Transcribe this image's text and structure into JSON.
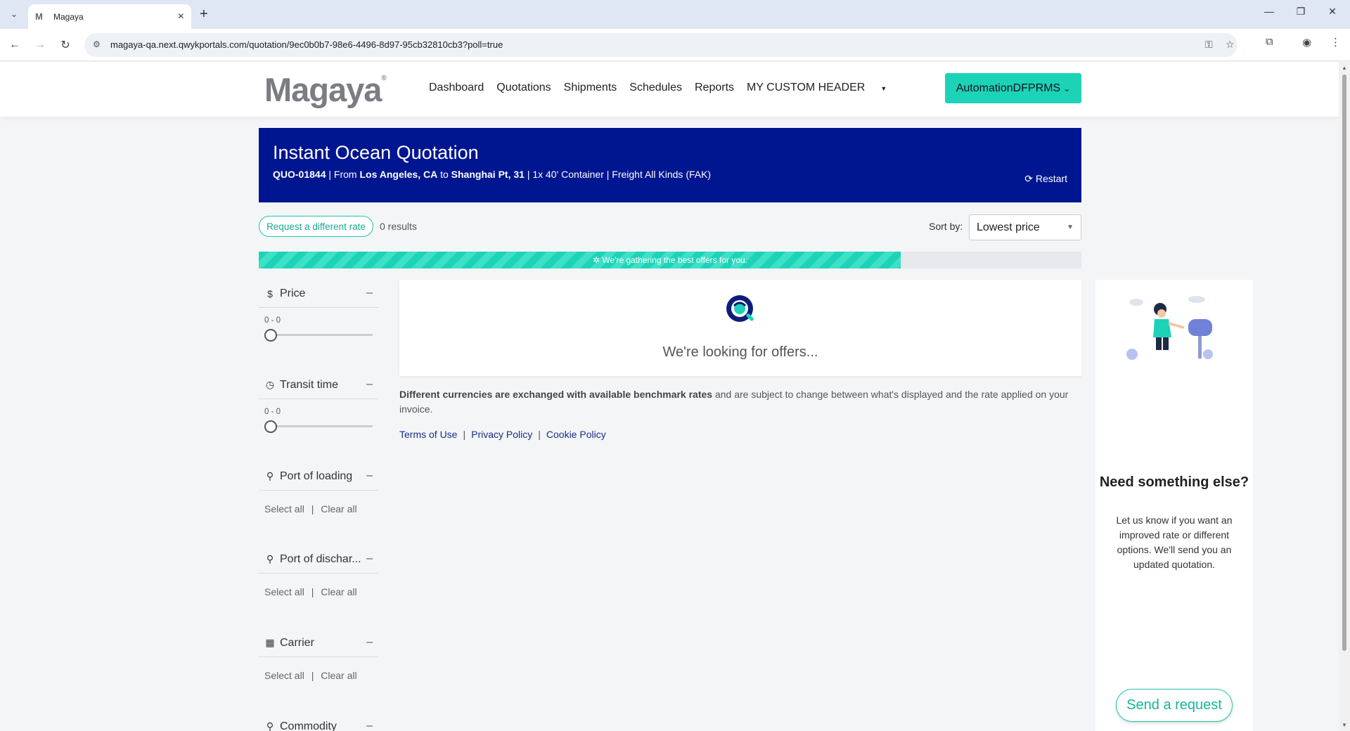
{
  "browser": {
    "tab_title": "Magaya",
    "tab_favicon": "M",
    "url": "magaya-qa.next.qwykportals.com/quotation/9ec0b0b7-98e6-4496-8d97-95cb32810cb3?poll=true"
  },
  "header": {
    "logo": "Magaya",
    "nav": [
      "Dashboard",
      "Quotations",
      "Shipments",
      "Schedules",
      "Reports",
      "MY CUSTOM HEADER"
    ],
    "user_label": "AutomationDFPRMS"
  },
  "banner": {
    "title": "Instant Ocean Quotation",
    "quote_id": "QUO-01844",
    "from_label": "| From",
    "origin": "Los Angeles, CA",
    "to_label": "to",
    "destination": "Shanghai Pt, 31",
    "details": "|  1x 40' Container | Freight All Kinds (FAK)",
    "restart_label": "Restart"
  },
  "toolbar": {
    "request_label": "Request a different rate",
    "results_text": "0 results",
    "sort_label": "Sort by:",
    "sort_value": "Lowest price"
  },
  "progress": {
    "text": "We're gathering the best offers for you.",
    "percent": 78
  },
  "filters": {
    "price": {
      "label": "Price",
      "range": "0 - 0"
    },
    "transit": {
      "label": "Transit time",
      "range": "0 - 0"
    },
    "pol": {
      "label": "Port of loading"
    },
    "pod": {
      "label": "Port of dischar..."
    },
    "carrier": {
      "label": "Carrier"
    },
    "commodity": {
      "label": "Commodity"
    },
    "select_all": "Select all",
    "clear_all": "Clear all",
    "sep": "|"
  },
  "main": {
    "looking_text": "We're looking for offers...",
    "disclaimer_bold": "Different currencies are exchanged with available benchmark rates",
    "disclaimer_rest": " and are subject to change between what's displayed and the rate applied on your invoice.",
    "terms": "Terms of Use",
    "privacy": "Privacy Policy",
    "cookie": "Cookie Policy",
    "link_sep": "|"
  },
  "help": {
    "title": "Need something else?",
    "text": "Let us know if you want an improved rate or different options. We'll send you an updated quotation.",
    "send_label": "Send a request"
  },
  "colors": {
    "accent": "#1dd3b7",
    "banner": "#001690",
    "link": "#1a2d8a"
  }
}
